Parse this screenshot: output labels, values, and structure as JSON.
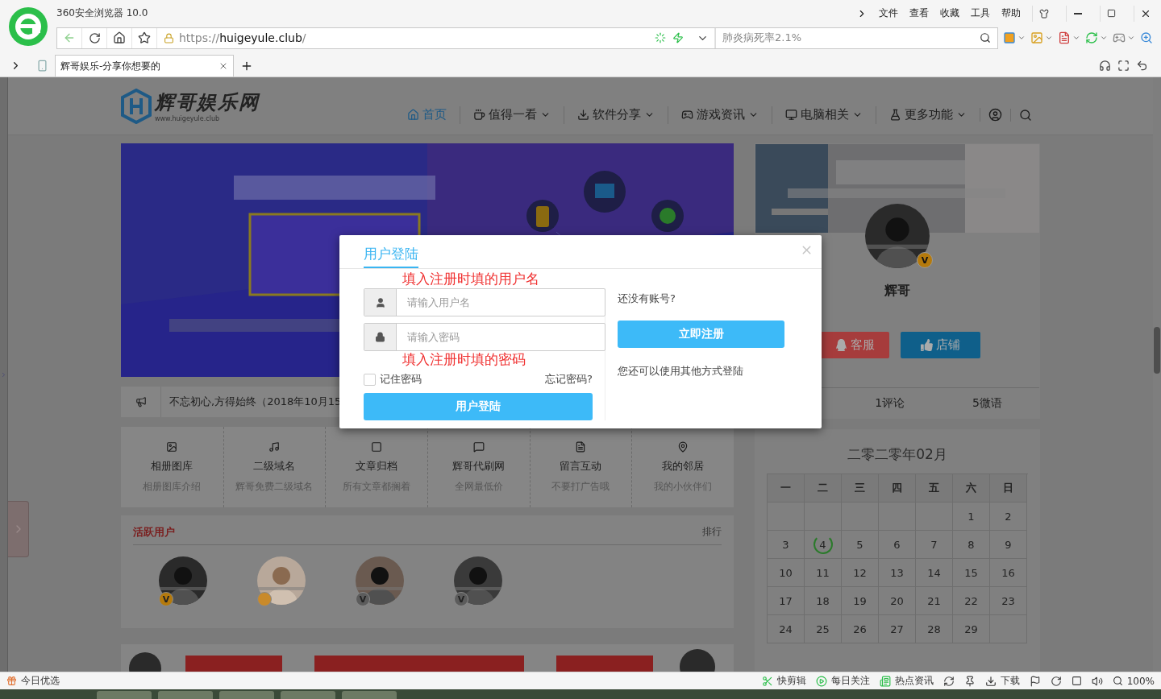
{
  "browser": {
    "title": "360安全浏览器 10.0",
    "menu": [
      "文件",
      "查看",
      "收藏",
      "工具",
      "帮助"
    ],
    "address": {
      "scheme": "https://",
      "host": "huigeyule.club",
      "path": "/"
    },
    "search": {
      "value": "肺炎病死率2.1%"
    },
    "tabs": [
      {
        "label": "辉哥娱乐-分享你想要的",
        "selected": true
      }
    ]
  },
  "site": {
    "logo": {
      "name": "辉哥娱乐网",
      "url": "www.huigeyule.club"
    },
    "nav": [
      {
        "label": "首页",
        "selected": true,
        "dropdown": false
      },
      {
        "label": "值得一看",
        "selected": false,
        "dropdown": true
      },
      {
        "label": "软件分享",
        "selected": false,
        "dropdown": true
      },
      {
        "label": "游戏资讯",
        "selected": false,
        "dropdown": true
      },
      {
        "label": "电脑相关",
        "selected": false,
        "dropdown": true
      },
      {
        "label": "更多功能",
        "selected": false,
        "dropdown": true
      }
    ],
    "notice": "不忘初心,方得始终（2018年10月15",
    "features": [
      {
        "title": "相册图库",
        "subtitle": "相册图库介绍"
      },
      {
        "title": "二级域名",
        "subtitle": "辉哥免费二级域名"
      },
      {
        "title": "文章归档",
        "subtitle": "所有文章都搁着"
      },
      {
        "title": "辉哥代刷网",
        "subtitle": "全网最低价"
      },
      {
        "title": "留言互动",
        "subtitle": "不要打广告哦"
      },
      {
        "title": "我的邻居",
        "subtitle": "我的小伙伴们"
      }
    ],
    "active_users": {
      "title": "活跃用户",
      "link": "排行",
      "users": [
        {
          "badge": "V",
          "color": "#b57a0c"
        },
        {
          "color": "#c98a2a"
        },
        {
          "badge": "V",
          "color": "#5c5c5c"
        },
        {
          "badge": "V",
          "color": "#5c5c5c"
        }
      ]
    },
    "profile": {
      "badge": "V",
      "name": "辉哥",
      "buttons": [
        {
          "label": "客服",
          "kind": "qq",
          "color": "#a63c3c"
        },
        {
          "label": "店铺",
          "kind": "like",
          "color": "#0f5f8a"
        }
      ],
      "stats": [
        "1评论",
        "5微语"
      ]
    },
    "calendar": {
      "title": "二零二零年02月",
      "weekdays": [
        "一",
        "二",
        "三",
        "四",
        "五",
        "六",
        "日"
      ],
      "weeks": [
        [
          {
            "kind": "empty"
          },
          {
            "kind": "empty"
          },
          {
            "kind": "empty"
          },
          {
            "kind": "empty"
          },
          {
            "kind": "empty"
          },
          {
            "kind": "day",
            "day": "1",
            "today": false
          },
          {
            "kind": "day",
            "day": "2",
            "today": false
          }
        ],
        [
          {
            "kind": "day",
            "day": "3",
            "today": false
          },
          {
            "kind": "day",
            "day": "4",
            "today": true
          },
          {
            "kind": "day",
            "day": "5",
            "today": false
          },
          {
            "kind": "day",
            "day": "6",
            "today": false
          },
          {
            "kind": "day",
            "day": "7",
            "today": false
          },
          {
            "kind": "day",
            "day": "8",
            "today": false
          },
          {
            "kind": "day",
            "day": "9",
            "today": false
          }
        ],
        [
          {
            "kind": "day",
            "day": "10",
            "today": false
          },
          {
            "kind": "day",
            "day": "11",
            "today": false
          },
          {
            "kind": "day",
            "day": "12",
            "today": false
          },
          {
            "kind": "day",
            "day": "13",
            "today": false
          },
          {
            "kind": "day",
            "day": "14",
            "today": false
          },
          {
            "kind": "day",
            "day": "15",
            "today": false
          },
          {
            "kind": "day",
            "day": "16",
            "today": false
          }
        ],
        [
          {
            "kind": "day",
            "day": "17",
            "today": false
          },
          {
            "kind": "day",
            "day": "18",
            "today": false
          },
          {
            "kind": "day",
            "day": "19",
            "today": false
          },
          {
            "kind": "day",
            "day": "20",
            "today": false
          },
          {
            "kind": "day",
            "day": "21",
            "today": false
          },
          {
            "kind": "day",
            "day": "22",
            "today": false
          },
          {
            "kind": "day",
            "day": "23",
            "today": false
          }
        ],
        [
          {
            "kind": "day",
            "day": "24",
            "today": false
          },
          {
            "kind": "day",
            "day": "25",
            "today": false
          },
          {
            "kind": "day",
            "day": "26",
            "today": false
          },
          {
            "kind": "day",
            "day": "27",
            "today": false
          },
          {
            "kind": "day",
            "day": "28",
            "today": false
          },
          {
            "kind": "day",
            "day": "29",
            "today": false
          },
          {
            "kind": "empty"
          }
        ]
      ]
    }
  },
  "login": {
    "tabs": [
      {
        "label": "用户登陆",
        "selected": true
      }
    ],
    "fields": [
      {
        "kind": "user",
        "placeholder": "请输入用户名",
        "annotation": "填入注册时填的用户名"
      },
      {
        "kind": "password",
        "placeholder": "请输入密码",
        "annotation": "填入注册时填的密码"
      }
    ],
    "remember": {
      "label": "记住密码",
      "checked": false
    },
    "forgot": "忘记密码?",
    "submit": "用户登陆",
    "register_prompt": "还没有账号?",
    "register": "立即注册",
    "other_login": "您还可以使用其他方式登陆"
  },
  "status_bar": {
    "left": "今日优选",
    "items": [
      "快剪辑",
      "每日关注",
      "热点资讯"
    ],
    "download": "下载",
    "zoom": "100%"
  }
}
